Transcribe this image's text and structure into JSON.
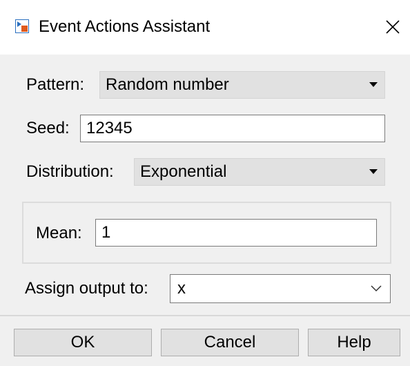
{
  "window": {
    "title": "Event Actions Assistant",
    "close_glyph": "✕"
  },
  "form": {
    "pattern_label": "Pattern:",
    "pattern_value": "Random number",
    "seed_label": "Seed:",
    "seed_value": "12345",
    "distribution_label": "Distribution:",
    "distribution_value": "Exponential",
    "mean_label": "Mean:",
    "mean_value": "1",
    "assign_label": "Assign output to:",
    "assign_value": "x"
  },
  "buttons": {
    "ok": "OK",
    "cancel": "Cancel",
    "help": "Help"
  },
  "icons": {
    "app": "simulink-app-icon",
    "close": "close-icon",
    "dropdown": "caret-down-icon",
    "chevron": "chevron-down-icon"
  },
  "colors": {
    "title_bg": "#ffffff",
    "dialog_bg": "#f0f0f0",
    "combo_bg": "#e1e1e1",
    "icon_orange": "#e05a1c",
    "icon_blue": "#2a6fbf"
  }
}
